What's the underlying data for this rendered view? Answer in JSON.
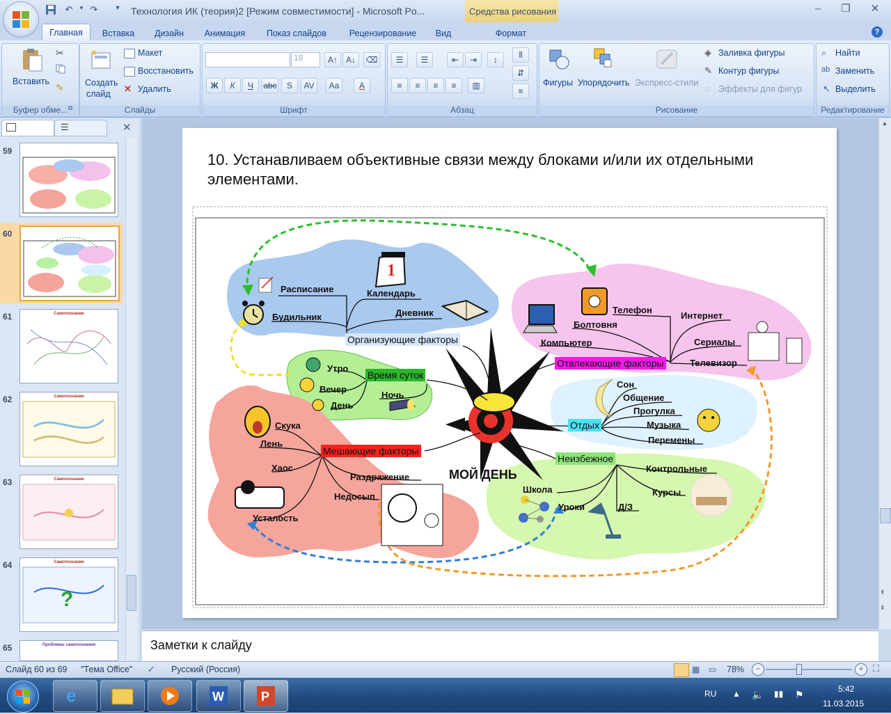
{
  "window": {
    "title": "Технология ИК (теория)2 [Режим совместимости] - Microsoft Po...",
    "context_tab_title": "Средства рисования"
  },
  "tabs": [
    "Главная",
    "Вставка",
    "Дизайн",
    "Анимация",
    "Показ слайдов",
    "Рецензирование",
    "Вид",
    "Формат"
  ],
  "ribbon": {
    "clipboard": {
      "paste": "Вставить",
      "label": "Буфер обме..."
    },
    "slides": {
      "new_slide_1": "Создать",
      "new_slide_2": "слайд",
      "layout": "Макет",
      "reset": "Восстановить",
      "delete": "Удалить",
      "label": "Слайды"
    },
    "font": {
      "size": "18",
      "bold": "Ж",
      "italic": "К",
      "underline": "Ч",
      "strike": "abc",
      "shadow": "S",
      "spacing": "AV",
      "case": "Aa",
      "color": "A",
      "label": "Шрифт"
    },
    "paragraph": {
      "label": "Абзац"
    },
    "drawing": {
      "shapes": "Фигуры",
      "arrange": "Упорядочить",
      "quick_styles": "Экспресс-стили",
      "fill": "Заливка фигуры",
      "outline": "Контур фигуры",
      "effects": "Эффекты для фигур",
      "label": "Рисование"
    },
    "editing": {
      "find": "Найти",
      "replace": "Заменить",
      "select": "Выделить",
      "label": "Редактирование"
    }
  },
  "thumbnails": [
    {
      "num": "59",
      "title": ""
    },
    {
      "num": "60",
      "title": ""
    },
    {
      "num": "61",
      "title": "Самопознание"
    },
    {
      "num": "62",
      "title": "Самопознание"
    },
    {
      "num": "63",
      "title": "Самопознание"
    },
    {
      "num": "64",
      "title": "Самопознание"
    },
    {
      "num": "65",
      "title": "Проблемы самопознания"
    }
  ],
  "slide": {
    "title": "10. Устанавливаем объективные связи между блоками и/или их отдельными элементами.",
    "center_label": "МОЙ ДЕНЬ",
    "organizing": {
      "label": "Организующие факторы",
      "items": [
        "Расписание",
        "Календарь",
        "Будильник",
        "Дневник"
      ]
    },
    "distracting": {
      "label": "Отвлекающие факторы",
      "items": [
        "Телефон",
        "Болтовня",
        "Компьютер",
        "Интернет",
        "Сериалы",
        "Телевизор"
      ]
    },
    "time": {
      "label": "Время суток",
      "items": [
        "Утро",
        "Вечер",
        "День",
        "Ночь"
      ]
    },
    "rest": {
      "label": "Отдых",
      "items": [
        "Сон",
        "Общение",
        "Прогулка",
        "Музыка",
        "Перемены"
      ]
    },
    "interfering": {
      "label": "Мешающие факторы",
      "items": [
        "Скука",
        "Лень",
        "Хаос",
        "Усталость",
        "Раздражение",
        "Недосып"
      ]
    },
    "inevitable": {
      "label": "Неизбежное",
      "items": [
        "Контрольные",
        "Курсы",
        "Школа",
        "Уроки",
        "Д/З"
      ]
    },
    "calendar_day": "1"
  },
  "notes_placeholder": "Заметки к слайду",
  "status": {
    "slide": "Слайд 60 из 69",
    "theme": "\"Тема Office\"",
    "language": "Русский (Россия)",
    "zoom": "78%"
  },
  "taskbar": {
    "lang": "RU",
    "time": "5:42",
    "date": "11.03.2015"
  }
}
